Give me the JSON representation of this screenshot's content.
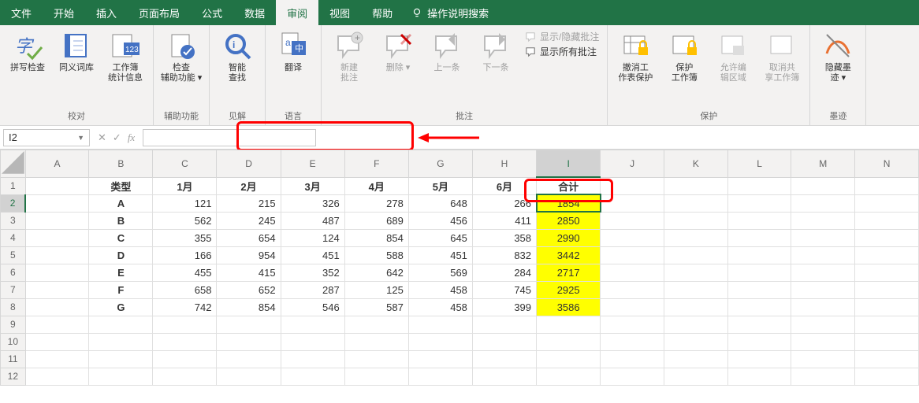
{
  "tabs": {
    "file": "文件",
    "home": "开始",
    "insert": "插入",
    "page_layout": "页面布局",
    "formulas": "公式",
    "data": "数据",
    "review": "审阅",
    "view": "视图",
    "help": "帮助",
    "tell_me": "操作说明搜索"
  },
  "ribbon": {
    "proofing": {
      "label": "校对",
      "spell": "拼写检查",
      "thesaurus": "同义词库",
      "stats": "工作簿\n统计信息"
    },
    "accessibility": {
      "label": "辅助功能",
      "check": "检查\n辅助功能"
    },
    "insights": {
      "label": "见解",
      "smart": "智能\n查找"
    },
    "language": {
      "label": "语言",
      "translate": "翻译"
    },
    "comments": {
      "label": "批注",
      "new": "新建\n批注",
      "delete": "删除",
      "prev": "上一条",
      "next": "下一条",
      "show_hide": "显示/隐藏批注",
      "show_all": "显示所有批注"
    },
    "protect": {
      "label": "保护",
      "unprotect": "撤消工\n作表保护",
      "protect_wb": "保护\n工作簿",
      "allow_edit": "允许编\n辑区域",
      "unshare": "取消共\n享工作簿"
    },
    "ink": {
      "label": "墨迹",
      "hide": "隐藏墨\n迹"
    }
  },
  "formula_bar": {
    "name_box": "I2",
    "value": ""
  },
  "sheet": {
    "columns": [
      "A",
      "B",
      "C",
      "D",
      "E",
      "F",
      "G",
      "H",
      "I",
      "J",
      "K",
      "L",
      "M",
      "N"
    ],
    "row_numbers": [
      "1",
      "2",
      "3",
      "4",
      "5",
      "6",
      "7",
      "8",
      "9",
      "10",
      "11",
      "12"
    ],
    "header_row": [
      "",
      "类型",
      "1月",
      "2月",
      "3月",
      "4月",
      "5月",
      "6月",
      "合计",
      "",
      "",
      "",
      "",
      ""
    ],
    "data": [
      [
        "",
        "A",
        "121",
        "215",
        "326",
        "278",
        "648",
        "266",
        "1854",
        "",
        "",
        "",
        "",
        ""
      ],
      [
        "",
        "B",
        "562",
        "245",
        "487",
        "689",
        "456",
        "411",
        "2850",
        "",
        "",
        "",
        "",
        ""
      ],
      [
        "",
        "C",
        "355",
        "654",
        "124",
        "854",
        "645",
        "358",
        "2990",
        "",
        "",
        "",
        "",
        ""
      ],
      [
        "",
        "D",
        "166",
        "954",
        "451",
        "588",
        "451",
        "832",
        "3442",
        "",
        "",
        "",
        "",
        ""
      ],
      [
        "",
        "E",
        "455",
        "415",
        "352",
        "642",
        "569",
        "284",
        "2717",
        "",
        "",
        "",
        "",
        ""
      ],
      [
        "",
        "F",
        "658",
        "652",
        "287",
        "125",
        "458",
        "745",
        "2925",
        "",
        "",
        "",
        "",
        ""
      ],
      [
        "",
        "G",
        "742",
        "854",
        "546",
        "587",
        "458",
        "399",
        "3586",
        "",
        "",
        "",
        "",
        ""
      ]
    ],
    "active_cell": "I2",
    "highlight_col_index": 8
  },
  "chart_data": {
    "type": "table",
    "title": "",
    "columns": [
      "类型",
      "1月",
      "2月",
      "3月",
      "4月",
      "5月",
      "6月",
      "合计"
    ],
    "rows": [
      {
        "类型": "A",
        "1月": 121,
        "2月": 215,
        "3月": 326,
        "4月": 278,
        "5月": 648,
        "6月": 266,
        "合计": 1854
      },
      {
        "类型": "B",
        "1月": 562,
        "2月": 245,
        "3月": 487,
        "4月": 689,
        "5月": 456,
        "6月": 411,
        "合计": 2850
      },
      {
        "类型": "C",
        "1月": 355,
        "2月": 654,
        "3月": 124,
        "4月": 854,
        "5月": 645,
        "6月": 358,
        "合计": 2990
      },
      {
        "类型": "D",
        "1月": 166,
        "2月": 954,
        "3月": 451,
        "4月": 588,
        "5月": 451,
        "6月": 832,
        "合计": 3442
      },
      {
        "类型": "E",
        "1月": 455,
        "2月": 415,
        "3月": 352,
        "4月": 642,
        "5月": 569,
        "6月": 284,
        "合计": 2717
      },
      {
        "类型": "F",
        "1月": 658,
        "2月": 652,
        "3月": 287,
        "4月": 125,
        "5月": 458,
        "6月": 745,
        "合计": 2925
      },
      {
        "类型": "G",
        "1月": 742,
        "2月": 854,
        "3月": 546,
        "4月": 587,
        "5月": 458,
        "6月": 399,
        "合计": 3586
      }
    ]
  }
}
